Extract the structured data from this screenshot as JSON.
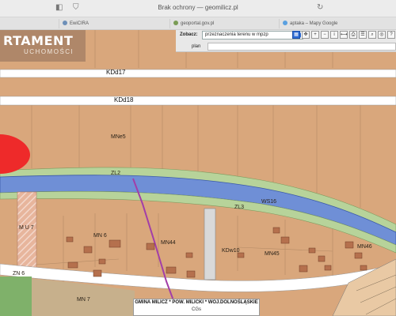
{
  "browser": {
    "url_text": "Brak ochrony — geomilicz.pl",
    "tabs": [
      "EwiCIRA",
      "geoportal.gov.pl",
      "aptaka – Mapy Google"
    ]
  },
  "logo": {
    "line1": "RTAMENT",
    "line2": "UCHOMOŚCI"
  },
  "toolbar": {
    "search_label": "Zobacz:",
    "search_value": "przeznaczenia terenu w mpzp",
    "plan_label": "plan"
  },
  "map": {
    "roads": [
      "KDd17",
      "KDd18"
    ],
    "labels": {
      "mne5": "MNe5",
      "zl2": "ZL2",
      "zl3": "ZL3",
      "ws16": "WS16",
      "mu7": "M U 7",
      "mn6": "MN 6",
      "mn44": "MN44",
      "kdw10": "KDw10",
      "mn45": "MN45",
      "mn46": "MN46",
      "zn6": "ZN 6",
      "mn7": "MN 7"
    }
  },
  "footer": {
    "title": "GMINA MILICZ * POW. MILICKI * WOJ.DOLNOŚLĄSKIE",
    "credit": "CGs"
  },
  "colors": {
    "parcel": "#d9a77c",
    "river": "#6f8fd6",
    "green": "#b7d39a",
    "road": "#ffffff",
    "path": "#a23ea8",
    "red": "#ee2a2a"
  }
}
